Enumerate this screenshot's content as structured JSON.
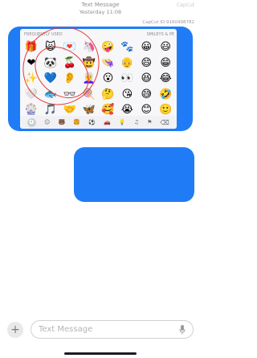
{
  "header": {
    "title": "Text Message",
    "subtitle": "Yesterday 11:08"
  },
  "watermark": {
    "top": "CapCut",
    "bottom": "CapCut ID:9160498782"
  },
  "keyboard": {
    "section_left": "FREQUENTLY USED",
    "section_right": "SMILEYS & PE",
    "rows": [
      [
        "🎁",
        "🙀",
        "💌",
        "🦄",
        "🤪",
        "🐾",
        "😀",
        "😃"
      ],
      [
        "❤",
        "🐼",
        "🍒",
        "🤠",
        "👒",
        "👴",
        "😄",
        "😁"
      ],
      [
        "✨",
        "💙",
        "👂",
        "👩‍🦳",
        "😮",
        "👀",
        "😆",
        "😂"
      ],
      [
        "🤍",
        "🐟",
        "👓",
        "🍭",
        "🤔",
        "😘",
        "😅",
        "🤣"
      ],
      [
        "🎡",
        "🎵",
        "🤝",
        "🦋",
        "🥰",
        "😭",
        "😊",
        "🙂"
      ],
      [
        "🎪",
        "🐛",
        "🦉",
        "🇵🇸",
        "😍",
        "🙂",
        "😇",
        "🤨"
      ]
    ],
    "categories": [
      "clock-icon",
      "smiley-icon",
      "animal-icon",
      "food-icon",
      "ball-icon",
      "car-icon",
      "bulb-icon",
      "symbols-icon",
      "flag-icon"
    ],
    "delete_icon": "delete-key-icon"
  },
  "composer": {
    "placeholder": "Text Message",
    "plus_icon": "plus-icon",
    "mic_icon": "mic-icon"
  },
  "colors": {
    "bubble": "#1f7cf6",
    "annotation": "#e53935"
  }
}
